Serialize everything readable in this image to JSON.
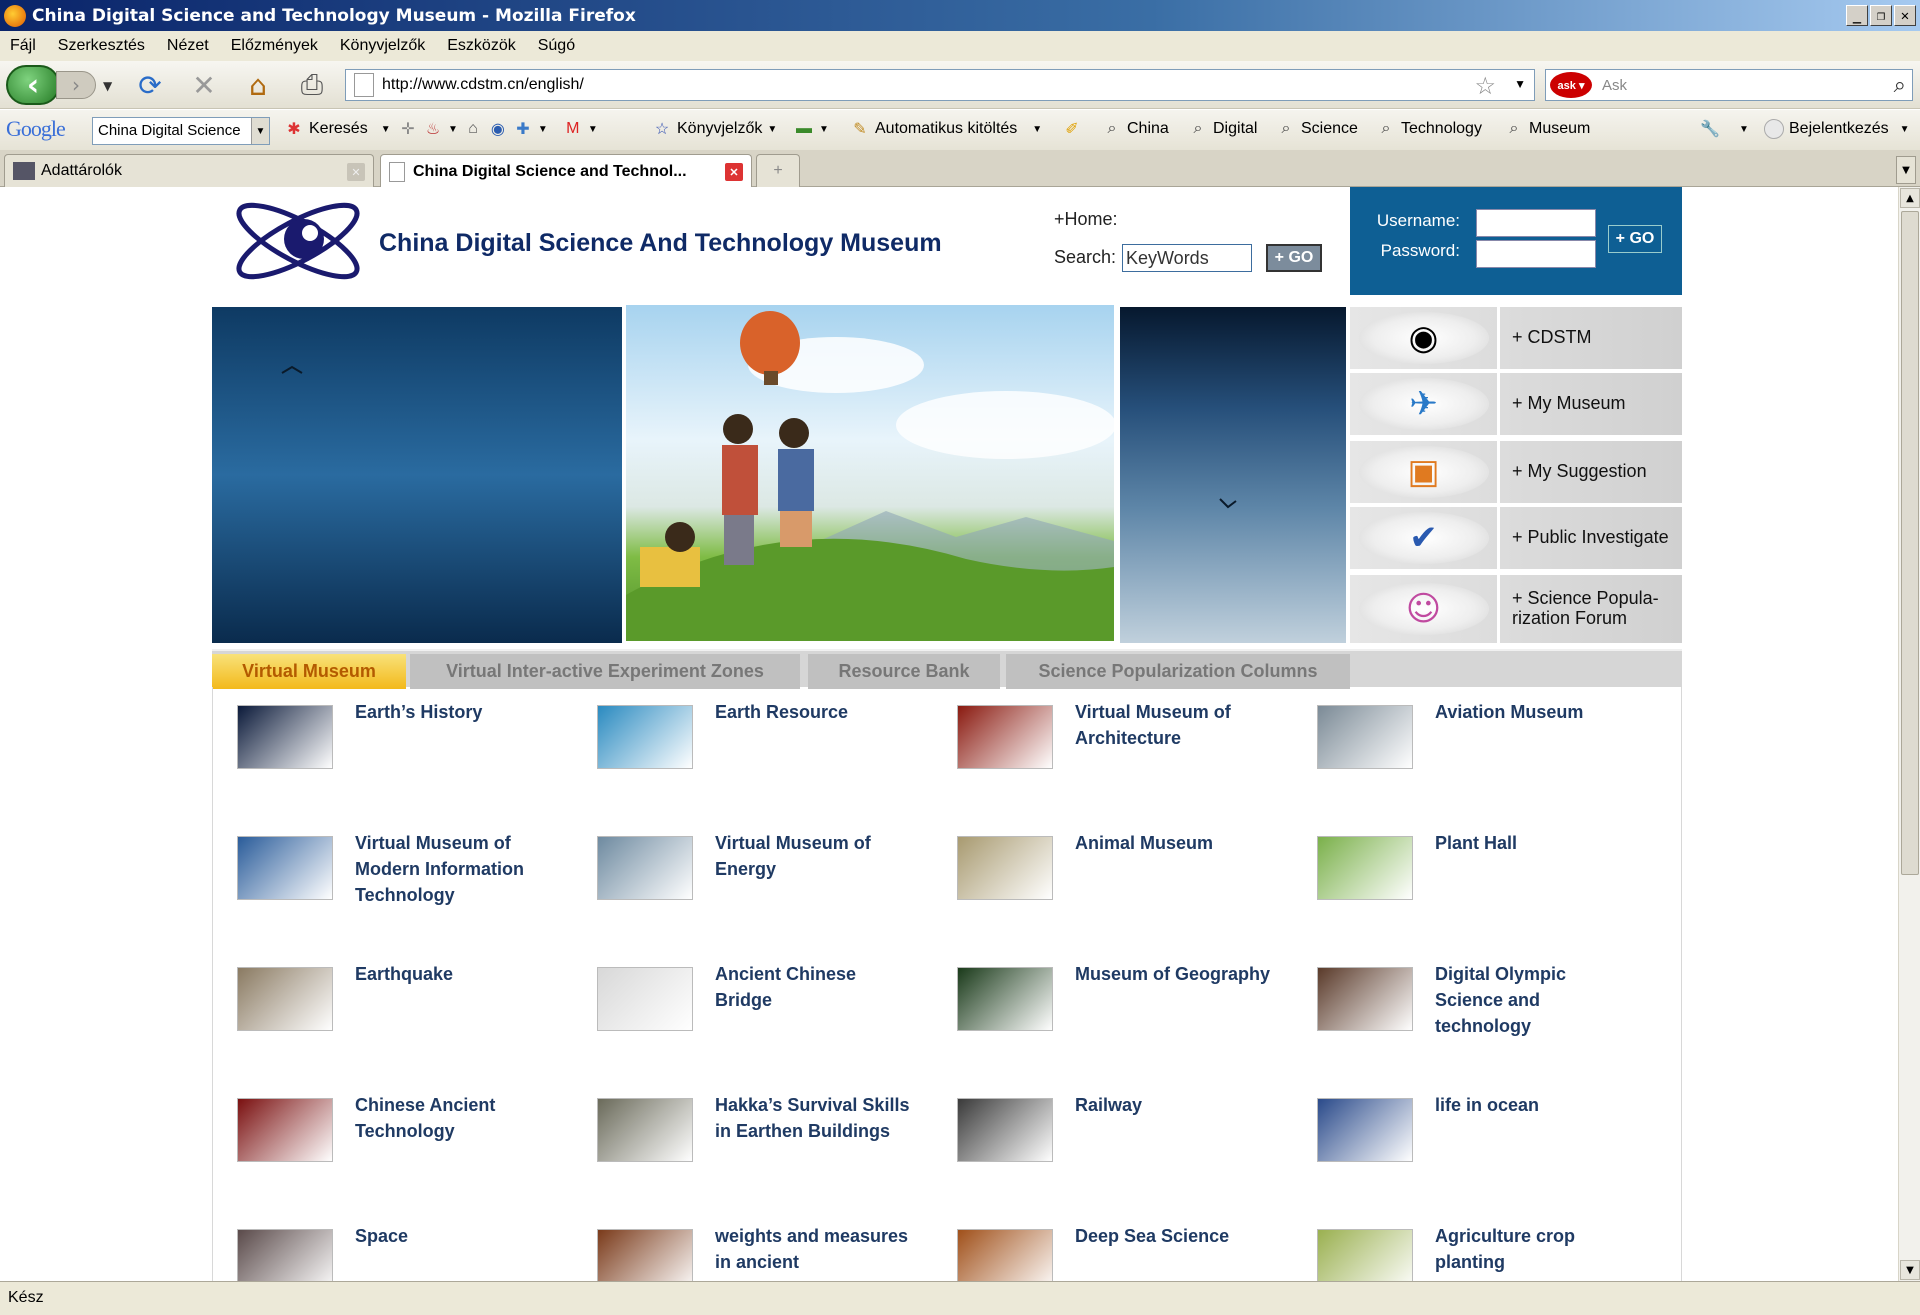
{
  "window": {
    "title": "China Digital Science and Technology Museum - Mozilla Firefox"
  },
  "menu": [
    "Fájl",
    "Szerkesztés",
    "Nézet",
    "Előzmények",
    "Könyvjelzők",
    "Eszközök",
    "Súgó"
  ],
  "nav": {
    "url": "http://www.cdstm.cn/english/",
    "search_placeholder": "Ask"
  },
  "google_toolbar": {
    "logo": "Google",
    "search_value": "China Digital Science",
    "search_label": "Keresés",
    "bookmarks_label": "Könyvjelzők",
    "autofill_label": "Automatikus kitöltés",
    "terms": [
      "China",
      "Digital",
      "Science",
      "Technology",
      "Museum"
    ],
    "signin_label": "Bejelentkezés"
  },
  "tabs": [
    {
      "label": "Adattárolók"
    },
    {
      "label": "China Digital Science and Technol..."
    }
  ],
  "status": "Kész",
  "site": {
    "title": "China Digital Science And Technology Museum",
    "home_link": "+Home:",
    "search_label": "Search:",
    "search_value": "KeyWords",
    "go_label": "+ GO",
    "username_label": "Username:",
    "password_label": "Password:",
    "login_go": "+ GO",
    "sidemenu": [
      {
        "label": "+ CDSTM",
        "icon": "eye-icon"
      },
      {
        "label": "+ My Museum",
        "icon": "globe-icon"
      },
      {
        "label": "+ My Suggestion",
        "icon": "computer-icon"
      },
      {
        "label": "+ Public Investigate",
        "icon": "checklist-icon"
      },
      {
        "label": "+ Science Popula-\nrization Forum",
        "icon": "people-icon"
      }
    ],
    "section_tabs": [
      "Virtual Museum",
      "Virtual Inter-active Experiment Zones",
      "Resource Bank",
      "Science Popularization Columns"
    ],
    "items": [
      {
        "label": "Earth’s History",
        "color": "#0b1a3a"
      },
      {
        "label": "Earth Resource",
        "color": "#2a8ac0"
      },
      {
        "label": "Virtual Museum of Architecture",
        "color": "#8a1a10"
      },
      {
        "label": "Aviation Museum",
        "color": "#7b8a96"
      },
      {
        "label": "Virtual Museum of Modern Information Technology",
        "color": "#2a5c9a"
      },
      {
        "label": "Virtual Museum of Energy",
        "color": "#6e8aa0"
      },
      {
        "label": "Animal Museum",
        "color": "#a89a70"
      },
      {
        "label": "Plant Hall",
        "color": "#7ab04a"
      },
      {
        "label": "Earthquake",
        "color": "#8a7a62"
      },
      {
        "label": "Ancient Chinese Bridge",
        "color": "#d8d8d8"
      },
      {
        "label": "Museum of Geography",
        "color": "#1a3a1a"
      },
      {
        "label": "Digital Olympic Science and technology",
        "color": "#5a3a2a"
      },
      {
        "label": "Chinese Ancient Technology",
        "color": "#7a1010"
      },
      {
        "label": "Hakka’s Survival Skills in Earthen Buildings",
        "color": "#6a6a5a"
      },
      {
        "label": "Railway",
        "color": "#3a3a3a"
      },
      {
        "label": "life in ocean",
        "color": "#2a4a8a"
      },
      {
        "label": "Space",
        "color": "#5a4a4a"
      },
      {
        "label": "weights and measures in ancient",
        "color": "#7a3a1a"
      },
      {
        "label": "Deep Sea Science",
        "color": "#a0501a"
      },
      {
        "label": "Agriculture crop planting",
        "color": "#9ab050"
      }
    ]
  }
}
